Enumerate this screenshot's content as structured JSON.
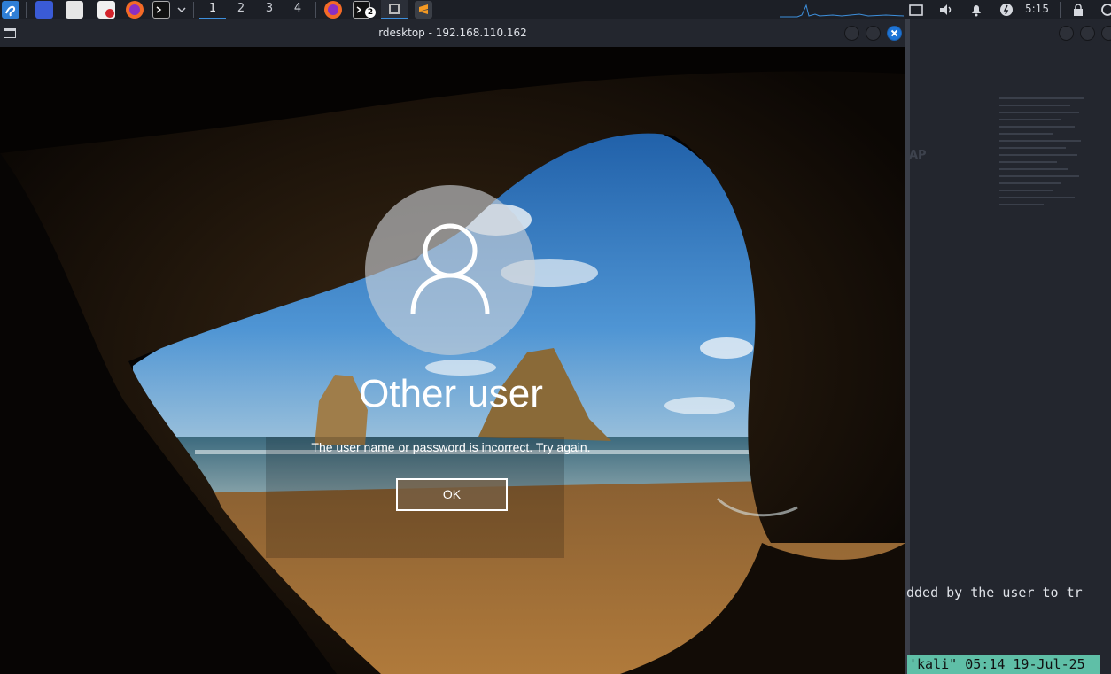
{
  "taskbar": {
    "workspaces": [
      "1",
      "2",
      "3",
      "4"
    ],
    "active_workspace": "1",
    "terminal_badge": "2",
    "clock": "5:15"
  },
  "window": {
    "title": "rdesktop - 192.168.110.162"
  },
  "lockscreen": {
    "username": "Other user",
    "message": "The user name or password is incorrect. Try again.",
    "ok_label": "OK"
  },
  "terminal": {
    "partial_heading": "AP",
    "visible_line": "dded by the user to tr",
    "status_line": "'kali\" 05:14 19-Jul-25"
  }
}
